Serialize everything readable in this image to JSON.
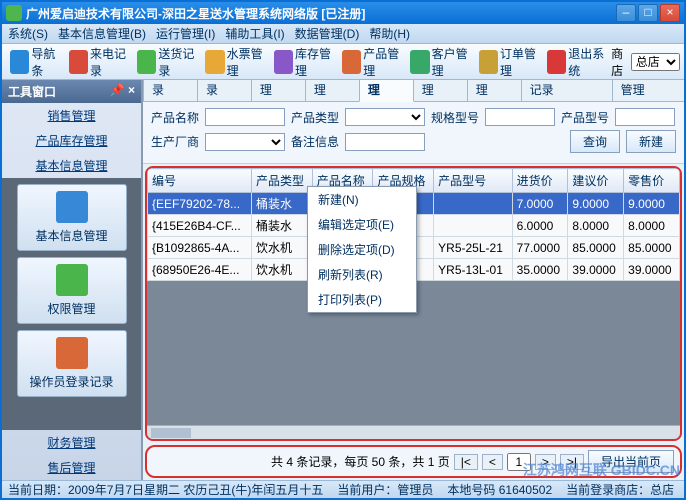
{
  "window": {
    "title": "广州爱启迪技术有限公司-深田之星送水管理系统网络版 [已注册]"
  },
  "menus": [
    "系统(S)",
    "基本信息管理(B)",
    "运行管理(I)",
    "辅助工具(I)",
    "数据管理(D)",
    "帮助(H)"
  ],
  "toolbar": [
    {
      "label": "导航条"
    },
    {
      "label": "来电记录"
    },
    {
      "label": "送货记录"
    },
    {
      "label": "水票管理"
    },
    {
      "label": "库存管理"
    },
    {
      "label": "产品管理"
    },
    {
      "label": "客户管理"
    },
    {
      "label": "订单管理"
    },
    {
      "label": "退出系统"
    }
  ],
  "store_label": "商店",
  "store_value": "总店",
  "sidebar": {
    "title": "工具窗口",
    "links": [
      "销售管理",
      "产品库存管理",
      "基本信息管理"
    ],
    "buttons": [
      "基本信息管理",
      "权限管理",
      "操作员登录记录"
    ],
    "footer_links": [
      "财务管理",
      "售后管理"
    ]
  },
  "tabs": [
    "来电记录",
    "送货记录",
    "水票管理",
    "库存管理",
    "产品管理",
    "客户管理",
    "订单管理",
    "操作人员登录记录",
    "基本信息管理"
  ],
  "active_tab": "产品管理",
  "filters": {
    "l_name": "产品名称",
    "l_type": "产品类型",
    "l_spec": "规格型号",
    "l_model": "产品型号",
    "l_factory": "生产厂商",
    "l_remark": "备注信息",
    "btn_query": "查询",
    "btn_new": "新建"
  },
  "grid": {
    "cols": [
      "编号",
      "产品类型",
      "产品名称",
      "产品规格",
      "产品型号",
      "进货价",
      "建议价",
      "零售价"
    ],
    "rows": [
      {
        "id": "{EEF79202-78...",
        "type": "桶装水",
        "name": "",
        "spec": "",
        "model": "",
        "pin": "7.0000",
        "psuggest": "9.0000",
        "pretail": "9.0000",
        "sel": true
      },
      {
        "id": "{415E26B4-CF...",
        "type": "桶装水",
        "name": "",
        "spec": "",
        "model": "",
        "pin": "6.0000",
        "psuggest": "8.0000",
        "pretail": "8.0000"
      },
      {
        "id": "{B1092865-4A...",
        "type": "饮水机",
        "name": "",
        "spec": "",
        "model": "YR5-25L-21",
        "pin": "77.0000",
        "psuggest": "85.0000",
        "pretail": "85.0000"
      },
      {
        "id": "{68950E26-4E...",
        "type": "饮水机",
        "name": "",
        "spec": "",
        "model": "YR5-13L-01",
        "pin": "35.0000",
        "psuggest": "39.0000",
        "pretail": "39.0000"
      }
    ]
  },
  "context_menu": [
    "新建(N)",
    "编辑选定项(E)",
    "删除选定项(D)",
    "刷新列表(R)",
    "打印列表(P)"
  ],
  "pager": {
    "summary": "共 4 条记录，每页 50 条，共 1 页",
    "page": "1",
    "export": "导出当前页"
  },
  "status": {
    "date": "当前日期：2009年7月7日星期二 农历己丑(牛)年闰五月十五",
    "user": "当前用户：管理员",
    "shop": "本地号码 61640502",
    "login": "当前登录商店：总店"
  },
  "watermark": "江苏鸿网互联 GBIDC.CN"
}
